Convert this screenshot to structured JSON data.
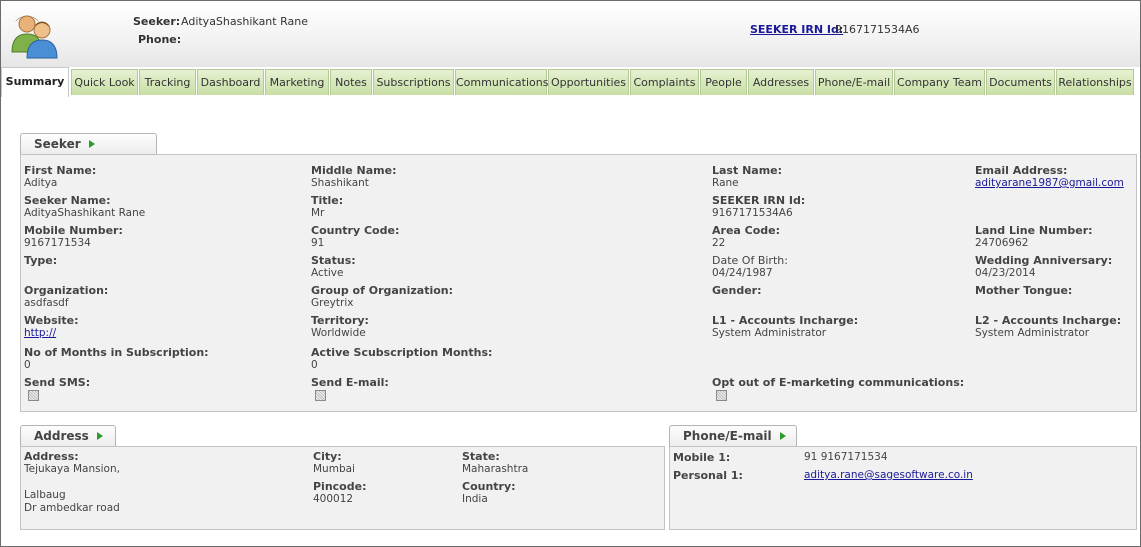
{
  "header": {
    "seeker_label": "Seeker:",
    "seeker_value": "AdityaShashikant Rane",
    "phone_label": "Phone:",
    "phone_value": "",
    "irn_label": "SEEKER IRN Id:",
    "irn_value": "9167171534A6",
    "avatar_icon": "users-icon"
  },
  "tabs": [
    {
      "label": "Summary",
      "active": true
    },
    {
      "label": "Quick Look"
    },
    {
      "label": "Tracking"
    },
    {
      "label": "Dashboard"
    },
    {
      "label": "Marketing"
    },
    {
      "label": "Notes"
    },
    {
      "label": "Subscriptions"
    },
    {
      "label": "Communications"
    },
    {
      "label": "Opportunities"
    },
    {
      "label": "Complaints"
    },
    {
      "label": "People"
    },
    {
      "label": "Addresses"
    },
    {
      "label": "Phone/E-mail"
    },
    {
      "label": "Company Team"
    },
    {
      "label": "Documents"
    },
    {
      "label": "Relationships"
    }
  ],
  "seeker": {
    "title": "Seeker",
    "first_name_label": "First Name:",
    "first_name": "Aditya",
    "middle_name_label": "Middle Name:",
    "middle_name": "Shashikant",
    "last_name_label": "Last Name:",
    "last_name": "Rane",
    "email_label": "Email Address:",
    "email": "adityarane1987@gmail.com",
    "seeker_name_label": "Seeker Name:",
    "seeker_name": "AdityaShashikant Rane",
    "title_label": "Title:",
    "title_value": "Mr",
    "irn_label": "SEEKER IRN Id:",
    "irn": "9167171534A6",
    "mobile_label": "Mobile Number:",
    "mobile": "9167171534",
    "country_code_label": "Country Code:",
    "country_code": "91",
    "area_code_label": "Area Code:",
    "area_code": "22",
    "landline_label": "Land Line Number:",
    "landline": "24706962",
    "type_label": "Type:",
    "type": "",
    "status_label": "Status:",
    "status": "Active",
    "dob_label": "Date Of Birth:",
    "dob": "04/24/1987",
    "wedding_label": "Wedding Anniversary:",
    "wedding": "04/23/2014",
    "org_label": "Organization:",
    "org": "asdfasdf",
    "group_org_label": "Group of Organization:",
    "group_org": "Greytrix",
    "gender_label": "Gender:",
    "gender": "",
    "mother_tongue_label": "Mother Tongue:",
    "mother_tongue": "",
    "website_label": "Website:",
    "website": "http://",
    "territory_label": "Territory:",
    "territory": "Worldwide",
    "l1_label": "L1 - Accounts Incharge:",
    "l1": "System Administrator",
    "l2_label": "L2 - Accounts Incharge:",
    "l2": "System Administrator",
    "months_sub_label": "No of Months in Subscription:",
    "months_sub": "0",
    "active_sub_label": "Active Scubscription Months:",
    "active_sub": "0",
    "send_sms_label": "Send SMS:",
    "send_email_label": "Send E-mail:",
    "opt_out_label": "Opt out of E-marketing communications:"
  },
  "address": {
    "title": "Address",
    "address_label": "Address:",
    "address_line1": "Tejukaya Mansion,",
    "address_line2": "Lalbaug",
    "address_line3": "Dr ambedkar road",
    "city_label": "City:",
    "city": "Mumbai",
    "state_label": "State:",
    "state": "Maharashtra",
    "pincode_label": "Pincode:",
    "pincode": "400012",
    "country_label": "Country:",
    "country": "India"
  },
  "phone_email": {
    "title": "Phone/E-mail",
    "mobile1_label": "Mobile 1:",
    "mobile1": "91 9167171534",
    "personal1_label": "Personal 1:",
    "personal1": "aditya.rane@sagesoftware.co.in"
  },
  "colors": {
    "tab_green": "#c8dfa4",
    "link": "#1a1a99",
    "arrow": "#2d9a2d"
  }
}
